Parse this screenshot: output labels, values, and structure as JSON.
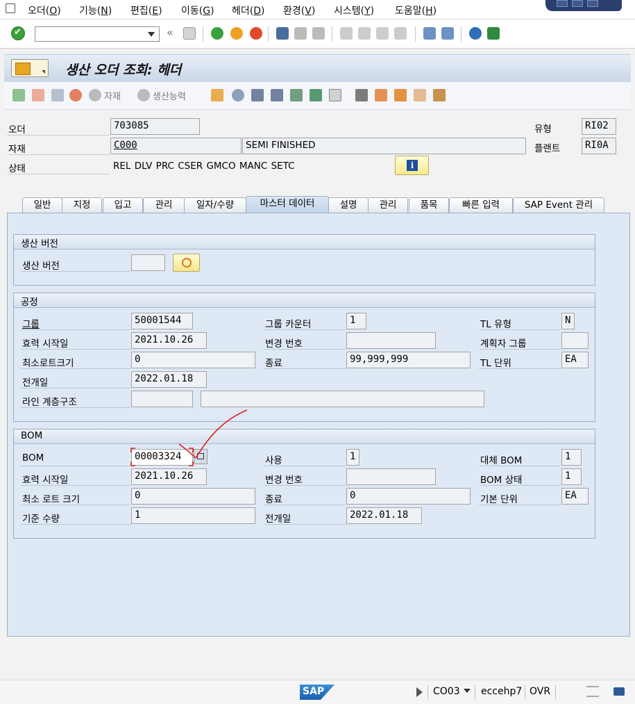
{
  "menu": [
    {
      "label": "오더",
      "key": "O"
    },
    {
      "label": "기능",
      "key": "N"
    },
    {
      "label": "편집",
      "key": "E"
    },
    {
      "label": "이동",
      "key": "G"
    },
    {
      "label": "헤더",
      "key": "D"
    },
    {
      "label": "환경",
      "key": "V"
    },
    {
      "label": "시스템",
      "key": "Y"
    },
    {
      "label": "도움말",
      "key": "H"
    }
  ],
  "toolbar": {
    "command_value": "",
    "back_glyph": "«"
  },
  "title": "생산 오더 조회: 헤더",
  "app_toolbar": {
    "material_label": "자재",
    "capacity_label": "생산능력"
  },
  "header": {
    "order_label": "오더",
    "order_value": "703085",
    "material_label": "자재",
    "material_value": "C000",
    "material_desc": "SEMI FINISHED",
    "status_label": "상태",
    "status_value": "REL  DLV  PRC  CSER GMCO MANC SETC",
    "type_label": "유형",
    "type_value": "RI02",
    "plant_label": "플랜트",
    "plant_value": "RI0A"
  },
  "tabs": [
    "일반",
    "지정",
    "입고",
    "관리",
    "일자/수량",
    "마스터 데이터",
    "설명",
    "관리",
    "품목",
    "빠른 입력",
    "SAP Event 관리"
  ],
  "active_tab": "마스터 데이터",
  "production_version": {
    "title": "생산 버전",
    "label": "생산 버전",
    "value": ""
  },
  "routing": {
    "title": "공정",
    "group_label": "그룹",
    "group_value": "50001544",
    "valid_from_label": "효력 시작일",
    "valid_from_value": "2021.10.26",
    "min_lot_label": "최소로트크기",
    "min_lot_value": "0",
    "explosion_date_label": "전개일",
    "explosion_date_value": "2022.01.18",
    "line_hierarchy_label": "라인 계층구조",
    "line_hierarchy_value": "",
    "line_hierarchy_desc": "",
    "group_counter_label": "그룹 카운터",
    "group_counter_value": "1",
    "change_no_label": "변경 번호",
    "change_no_value": "",
    "to_label": "종료",
    "to_value": "99,999,999",
    "tl_type_label": "TL 유형",
    "tl_type_value": "N",
    "planner_group_label": "계획자 그룹",
    "planner_group_value": "",
    "tl_unit_label": "TL 단위",
    "tl_unit_value": "EA"
  },
  "bom": {
    "title": "BOM",
    "bom_label": "BOM",
    "bom_value": "00003324",
    "valid_from_label": "효력 시작일",
    "valid_from_value": "2021.10.26",
    "min_lot_label": "최소 로트 크기",
    "min_lot_value": "0",
    "base_qty_label": "기준 수량",
    "base_qty_value": "1",
    "usage_label": "사용",
    "usage_value": "1",
    "change_no_label": "변경 번호",
    "change_no_value": "",
    "to_label": "종료",
    "to_value": "0",
    "explosion_date_label": "전개일",
    "explosion_date_value": "2022.01.18",
    "alt_bom_label": "대체 BOM",
    "alt_bom_value": "1",
    "bom_status_label": "BOM 상태",
    "bom_status_value": "1",
    "base_unit_label": "기본 단위",
    "base_unit_value": "EA"
  },
  "status_bar": {
    "logo": "SAP",
    "transaction": "CO03",
    "server": "ecc​ehp7",
    "mode": "OVR"
  },
  "colors": {
    "accent": "#1d4f9a",
    "annotation": "#e02020",
    "panel": "#dfe9f5"
  }
}
